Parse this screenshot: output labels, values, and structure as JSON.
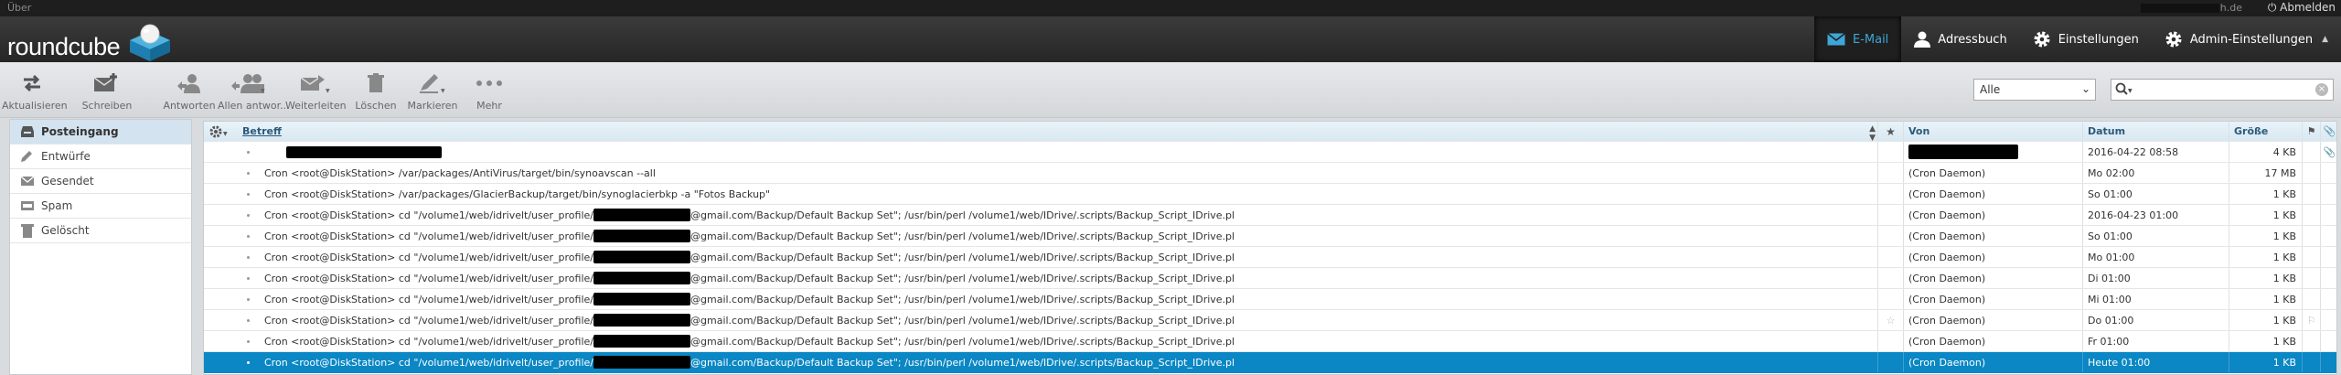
{
  "topbar": {
    "about": "Über",
    "user_suffix": "h.de",
    "logout": "Abmelden"
  },
  "logo": {
    "text": "roundcube"
  },
  "nav": [
    {
      "label": "E-Mail",
      "icon": "envelope-icon",
      "active": true
    },
    {
      "label": "Adressbuch",
      "icon": "person-icon"
    },
    {
      "label": "Einstellungen",
      "icon": "gear-icon"
    },
    {
      "label": "Admin-Einstellungen",
      "icon": "gear-icon"
    }
  ],
  "toolbar": {
    "refresh": "Aktualisieren",
    "compose": "Schreiben",
    "reply": "Antworten",
    "reply_all": "Allen antwor...",
    "forward": "Weiterleiten",
    "delete": "Löschen",
    "mark": "Markieren",
    "more": "Mehr"
  },
  "filter": {
    "value": "Alle"
  },
  "search": {
    "placeholder": ""
  },
  "folders": [
    {
      "label": "Posteingang",
      "icon": "inbox-icon",
      "active": true
    },
    {
      "label": "Entwürfe",
      "icon": "pencil-icon"
    },
    {
      "label": "Gesendet",
      "icon": "sent-icon"
    },
    {
      "label": "Spam",
      "icon": "spam-icon"
    },
    {
      "label": "Gelöscht",
      "icon": "trash-icon"
    }
  ],
  "list": {
    "headers": {
      "subject": "Betreff",
      "from": "Von",
      "date": "Datum",
      "size": "Größe"
    },
    "rows": [
      {
        "pre": "",
        "post": "",
        "redact_subject": true,
        "from": "",
        "redact_from": true,
        "date": "2016-04-22 08:58",
        "size": "4 KB",
        "attachment": true
      },
      {
        "pre": "Cron <root@DiskStation> /var/packages/AntiVirus/target/bin/synoavscan --all",
        "post": "",
        "from": "(Cron Daemon)",
        "date": "Mo 02:00",
        "size": "17 MB"
      },
      {
        "pre": "Cron <root@DiskStation> /var/packages/GlacierBackup/target/bin/synoglacierbkp -a \"Fotos Backup\"",
        "post": "",
        "from": "(Cron Daemon)",
        "date": "So 01:00",
        "size": "1 KB"
      },
      {
        "pre": "Cron <root@DiskStation> cd \"/volume1/web/idrivelt/user_profile/",
        "post": "@gmail.com/Backup/Default Backup Set\"; /usr/bin/perl /volume1/web/IDrive/.scripts/Backup_Script_IDrive.pl",
        "mid_redact": true,
        "from": "(Cron Daemon)",
        "date": "2016-04-23 01:00",
        "size": "1 KB"
      },
      {
        "pre": "Cron <root@DiskStation> cd \"/volume1/web/idrivelt/user_profile/",
        "post": "@gmail.com/Backup/Default Backup Set\"; /usr/bin/perl /volume1/web/IDrive/.scripts/Backup_Script_IDrive.pl",
        "mid_redact": true,
        "from": "(Cron Daemon)",
        "date": "So 01:00",
        "size": "1 KB"
      },
      {
        "pre": "Cron <root@DiskStation> cd \"/volume1/web/idrivelt/user_profile/",
        "post": "@gmail.com/Backup/Default Backup Set\"; /usr/bin/perl /volume1/web/IDrive/.scripts/Backup_Script_IDrive.pl",
        "mid_redact": true,
        "from": "(Cron Daemon)",
        "date": "Mo 01:00",
        "size": "1 KB"
      },
      {
        "pre": "Cron <root@DiskStation> cd \"/volume1/web/idrivelt/user_profile/",
        "post": "@gmail.com/Backup/Default Backup Set\"; /usr/bin/perl /volume1/web/IDrive/.scripts/Backup_Script_IDrive.pl",
        "mid_redact": true,
        "from": "(Cron Daemon)",
        "date": "Di 01:00",
        "size": "1 KB"
      },
      {
        "pre": "Cron <root@DiskStation> cd \"/volume1/web/idrivelt/user_profile/",
        "post": "@gmail.com/Backup/Default Backup Set\"; /usr/bin/perl /volume1/web/IDrive/.scripts/Backup_Script_IDrive.pl",
        "mid_redact": true,
        "from": "(Cron Daemon)",
        "date": "Mi 01:00",
        "size": "1 KB"
      },
      {
        "pre": "Cron <root@DiskStation> cd \"/volume1/web/idrivelt/user_profile/",
        "post": "@gmail.com/Backup/Default Backup Set\"; /usr/bin/perl /volume1/web/IDrive/.scripts/Backup_Script_IDrive.pl",
        "mid_redact": true,
        "from": "(Cron Daemon)",
        "date": "Do 01:00",
        "size": "1 KB",
        "hover_icons": true
      },
      {
        "pre": "Cron <root@DiskStation> cd \"/volume1/web/idrivelt/user_profile/",
        "post": "@gmail.com/Backup/Default Backup Set\"; /usr/bin/perl /volume1/web/IDrive/.scripts/Backup_Script_IDrive.pl",
        "mid_redact": true,
        "from": "(Cron Daemon)",
        "date": "Fr 01:00",
        "size": "1 KB"
      },
      {
        "pre": "Cron <root@DiskStation> cd \"/volume1/web/idrivelt/user_profile/",
        "post": "@gmail.com/Backup/Default Backup Set\"; /usr/bin/perl /volume1/web/IDrive/.scripts/Backup_Script_IDrive.pl",
        "mid_redact": true,
        "from": "(Cron Daemon)",
        "date": "Heute 01:00",
        "size": "1 KB",
        "selected": true
      }
    ]
  },
  "colors": {
    "accent": "#0a87c4",
    "nav_active": "#3ea6d8",
    "header_bg": "#262626"
  }
}
